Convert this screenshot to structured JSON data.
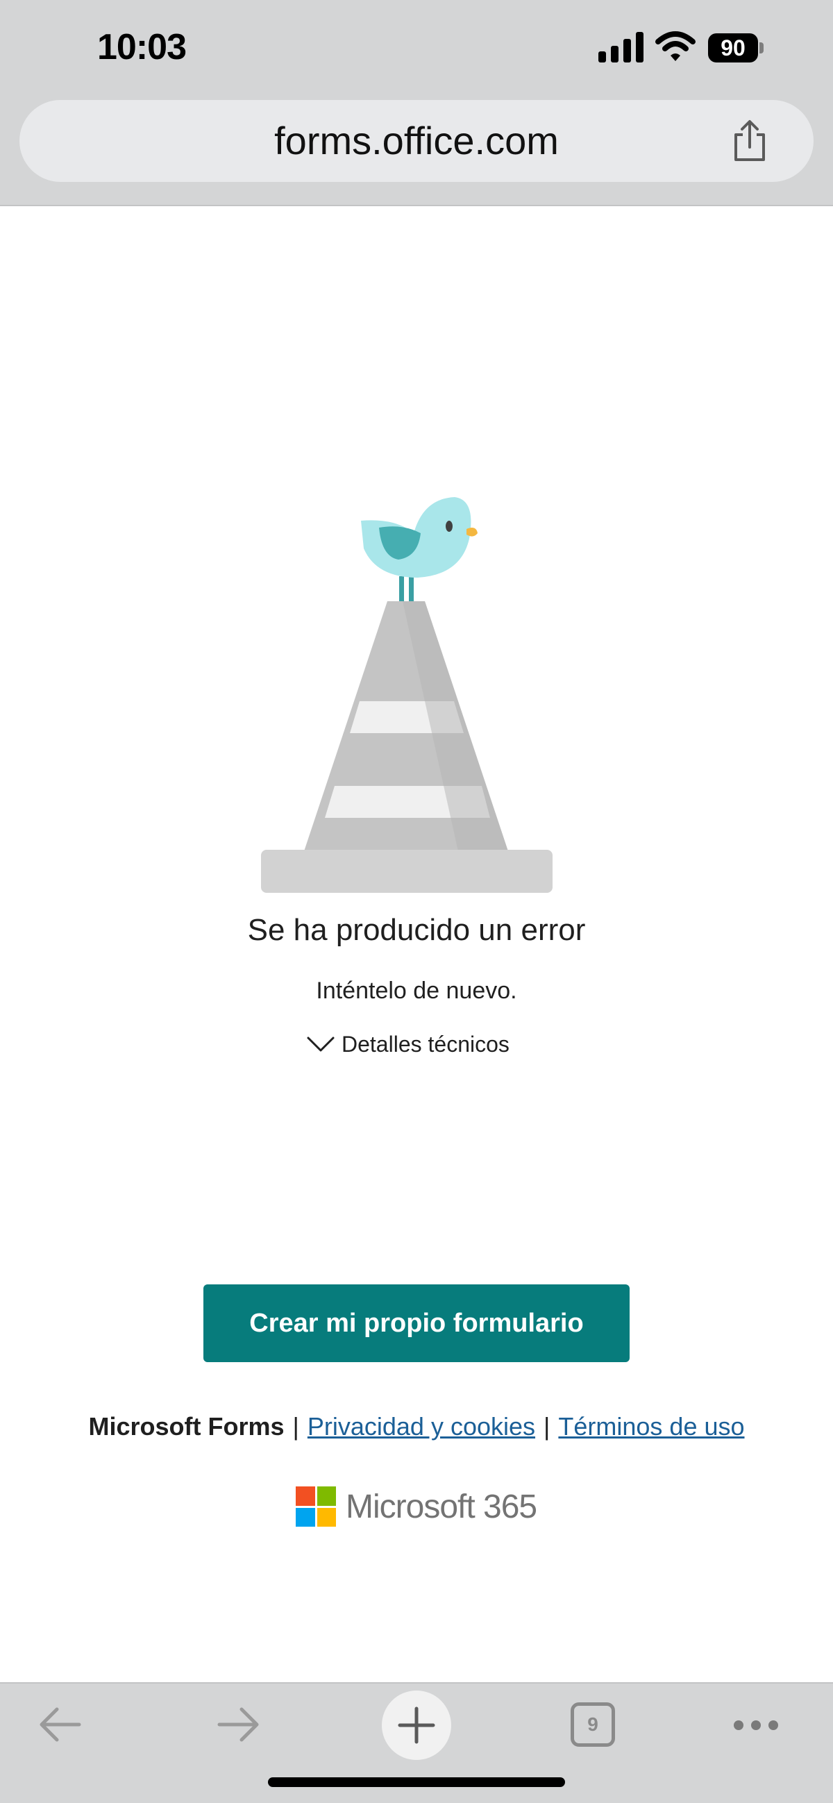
{
  "status_bar": {
    "time": "10:03",
    "battery_level": "90",
    "icons": [
      "signal-icon",
      "wifi-icon",
      "battery-icon"
    ]
  },
  "browser": {
    "url": "forms.office.com",
    "toolbar": {
      "tab_count": "9",
      "icons": [
        "back-arrow-icon",
        "forward-arrow-icon",
        "plus-icon",
        "tabs-icon",
        "more-icon",
        "share-icon"
      ]
    }
  },
  "main": {
    "illustration": "cone-with-bird",
    "error_title": "Se ha producido un error",
    "error_subtitle": "Inténtelo de nuevo.",
    "details_label": "Detalles técnicos",
    "primary_button": "Crear mi propio formulario"
  },
  "footer": {
    "brand": "Microsoft Forms",
    "separator": "|",
    "privacy_link": "Privacidad y cookies",
    "terms_link": "Términos de uso",
    "logo_text": "Microsoft 365"
  },
  "colors": {
    "accent": "#077c7c",
    "link": "#1b5f97",
    "chrome_bg": "#d4d5d6",
    "ms_red": "#f25022",
    "ms_green": "#7fba00",
    "ms_blue": "#00a4ef",
    "ms_yellow": "#ffb900"
  }
}
